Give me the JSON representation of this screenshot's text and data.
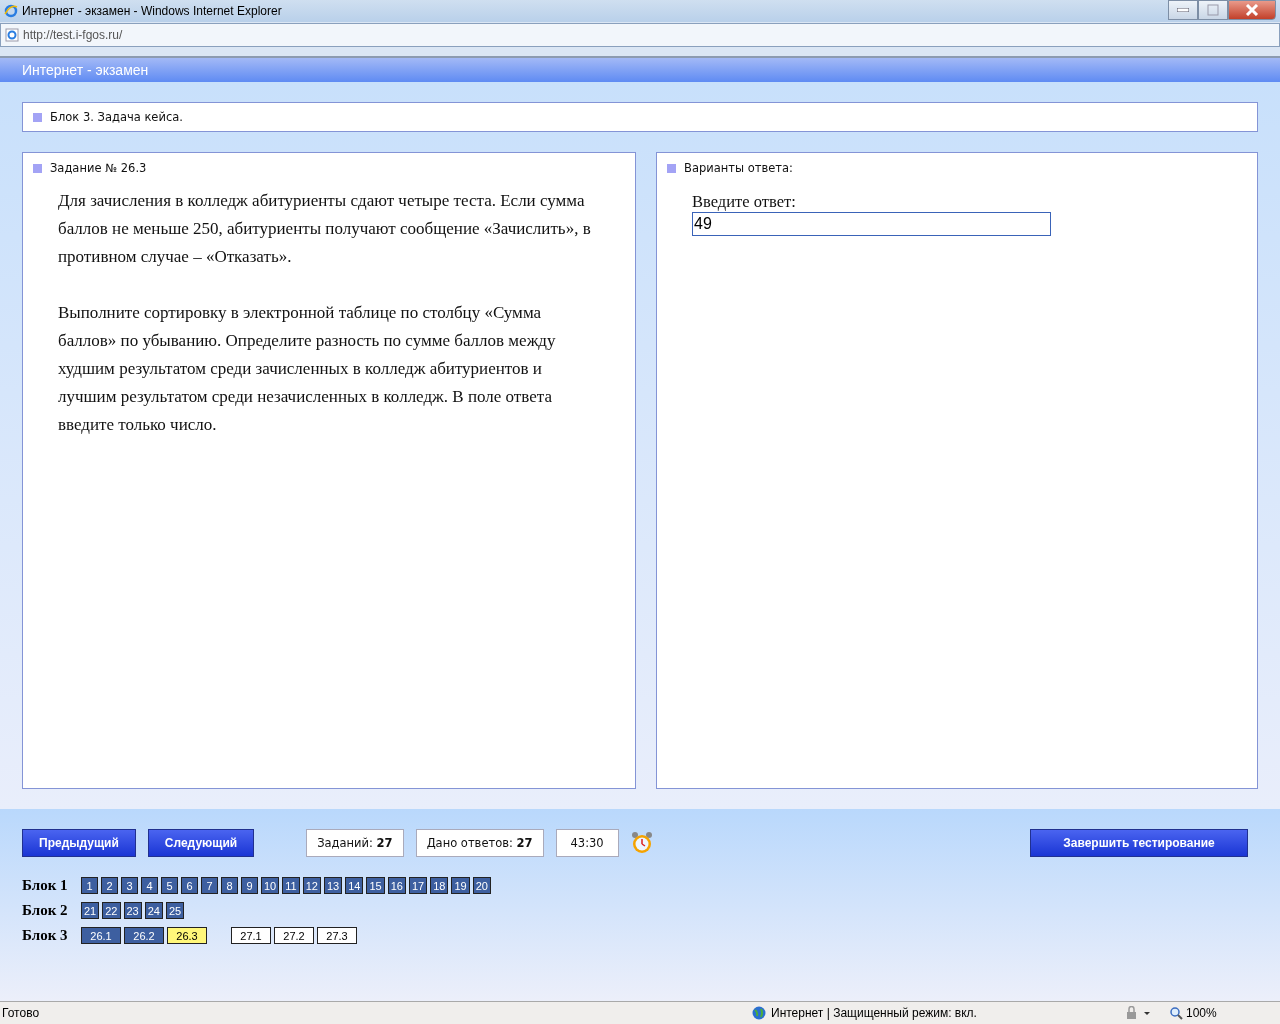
{
  "window": {
    "title": "Интернет - экзамен - Windows Internet Explorer"
  },
  "address": "http://test.i-fgos.ru/",
  "app_title": "Интернет - экзамен",
  "block_header": "Блок 3. Задача кейса.",
  "task": {
    "title": "Задание № 26.3",
    "paragraphs": [
      "Для зачисления в колледж абитуриенты сдают четыре теста. Если сумма баллов не меньше 250, абитуриенты получают сообщение «Зачислить», в противном случае – «Отказать».",
      "Выполните сортировку в электронной таблице по столбцу «Сумма баллов» по убыванию. Определите разность по сумме баллов между худшим результатом среди зачисленных в колледж абитуриентов и лучшим результатом среди незачисленных в колледж. В поле ответа введите только число."
    ]
  },
  "answer": {
    "title": "Варианты ответа:",
    "label": "Введите ответ:",
    "value": "49"
  },
  "buttons": {
    "prev": "Предыдущий",
    "next": "Следующий",
    "finish": "Завершить тестирование"
  },
  "counters": [
    {
      "label": "Заданий:",
      "value": "27"
    },
    {
      "label": "Дано ответов:",
      "value": "27"
    }
  ],
  "timer": "43:30",
  "blocks": [
    {
      "label": "Блок 1",
      "groups": [
        [
          {
            "label": "1",
            "kind": "answered"
          },
          {
            "label": "2",
            "kind": "answered"
          },
          {
            "label": "3",
            "kind": "answered"
          },
          {
            "label": "4",
            "kind": "answered"
          },
          {
            "label": "5",
            "kind": "answered"
          },
          {
            "label": "6",
            "kind": "answered"
          },
          {
            "label": "7",
            "kind": "answered"
          },
          {
            "label": "8",
            "kind": "answered"
          },
          {
            "label": "9",
            "kind": "answered"
          },
          {
            "label": "10",
            "kind": "answered"
          },
          {
            "label": "11",
            "kind": "answered"
          },
          {
            "label": "12",
            "kind": "answered"
          },
          {
            "label": "13",
            "kind": "answered"
          },
          {
            "label": "14",
            "kind": "answered"
          },
          {
            "label": "15",
            "kind": "answered"
          },
          {
            "label": "16",
            "kind": "answered"
          },
          {
            "label": "17",
            "kind": "answered"
          },
          {
            "label": "18",
            "kind": "answered"
          },
          {
            "label": "19",
            "kind": "answered"
          },
          {
            "label": "20",
            "kind": "answered"
          }
        ]
      ]
    },
    {
      "label": "Блок 2",
      "groups": [
        [
          {
            "label": "21",
            "kind": "answered"
          },
          {
            "label": "22",
            "kind": "answered"
          },
          {
            "label": "23",
            "kind": "answered"
          },
          {
            "label": "24",
            "kind": "answered"
          },
          {
            "label": "25",
            "kind": "answered"
          }
        ]
      ]
    },
    {
      "label": "Блок 3",
      "groups": [
        [
          {
            "label": "26.1",
            "kind": "answered"
          },
          {
            "label": "26.2",
            "kind": "answered"
          },
          {
            "label": "26.3",
            "kind": "current"
          }
        ],
        [
          {
            "label": "27.1",
            "kind": "open"
          },
          {
            "label": "27.2",
            "kind": "open"
          },
          {
            "label": "27.3",
            "kind": "open"
          }
        ]
      ]
    }
  ],
  "status_bar": {
    "text": "Готово",
    "zone": "Интернет | Защищенный режим: вкл.",
    "zoom": "100%"
  }
}
